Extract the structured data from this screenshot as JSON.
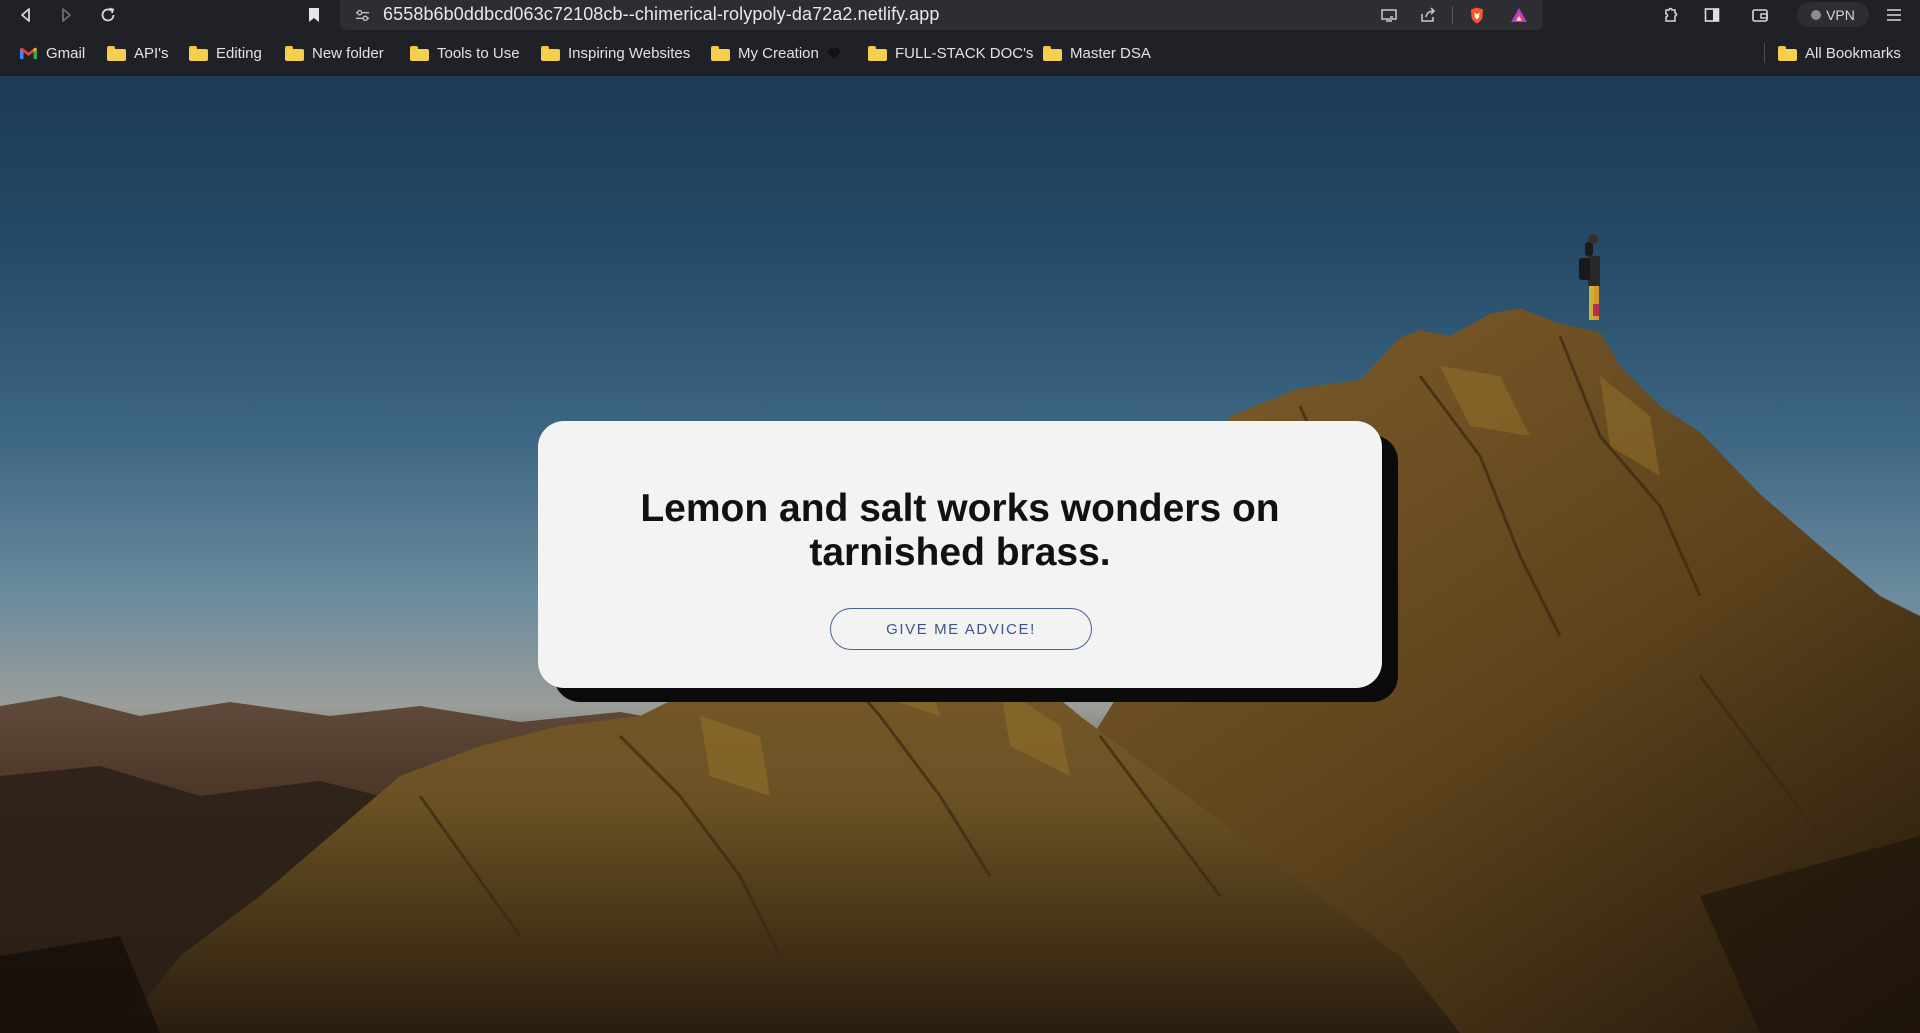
{
  "browser": {
    "url": "6558b6b0ddbcd063c72108cb--chimerical-rolypoly-da72a2.netlify.app",
    "vpn_label": "VPN",
    "icons": [
      "back-icon",
      "forward-icon",
      "reload-icon",
      "bookmark-icon",
      "site-info-icon",
      "cast-icon",
      "share-icon",
      "brave-shields-icon",
      "brave-rewards-icon",
      "extensions-icon",
      "sidebar-icon",
      "wallet-icon",
      "menu-icon"
    ]
  },
  "bookmarks": {
    "items": [
      {
        "label": "Gmail",
        "icon": "gmail-icon"
      },
      {
        "label": "API's",
        "icon": "folder-icon"
      },
      {
        "label": "Editing",
        "icon": "folder-icon"
      },
      {
        "label": "New folder",
        "icon": "folder-icon"
      },
      {
        "label": "Tools to Use",
        "icon": "folder-icon"
      },
      {
        "label": "Inspiring Websites",
        "icon": "folder-icon"
      },
      {
        "label": "My Creation",
        "icon": "folder-icon"
      },
      {
        "label": "FULL-STACK DOC's",
        "icon": "folder-icon"
      },
      {
        "label": "Master DSA",
        "icon": "folder-icon"
      }
    ],
    "all_bookmarks_label": "All Bookmarks"
  },
  "card": {
    "advice": "Lemon and salt works wonders on tarnished brass.",
    "button_label": "GIVE ME ADVICE!"
  },
  "colors": {
    "card_bg": "#f3f3f4",
    "button_accent": "#3e5688",
    "chrome_bg": "#202127"
  }
}
